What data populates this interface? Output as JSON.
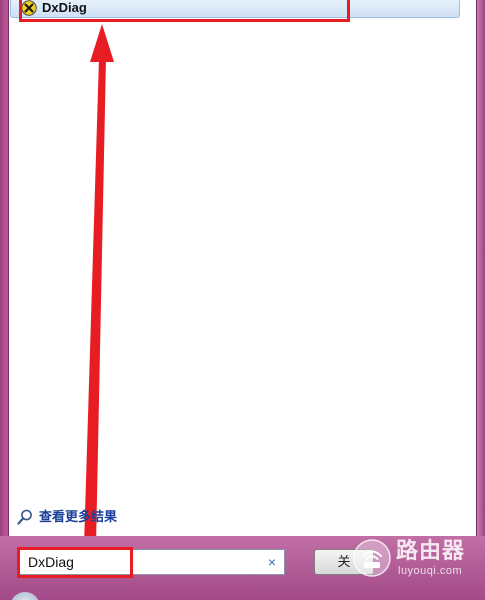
{
  "result": {
    "label": "DxDiag",
    "icon": "dxdiag-icon"
  },
  "see_more": {
    "label": "查看更多结果",
    "icon": "search-icon"
  },
  "search": {
    "value": "DxDiag",
    "clear_symbol": "×"
  },
  "shutdown": {
    "label": "关"
  },
  "watermark": {
    "title": "路由器",
    "subtitle": "luyouqi.com"
  },
  "colors": {
    "annotation": "#e81d24",
    "link": "#1a3f9a",
    "accent": "#b44a8e"
  }
}
